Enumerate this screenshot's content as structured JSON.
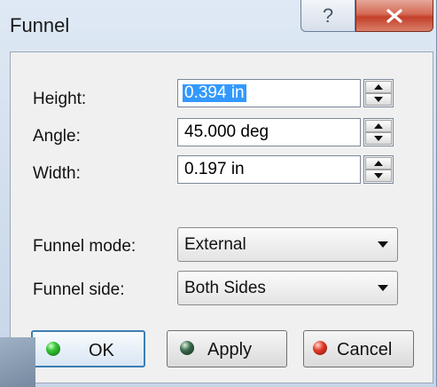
{
  "window": {
    "title": "Funnel"
  },
  "titlebar": {
    "help_glyph": "?",
    "close_icon": "close-icon"
  },
  "params": [
    {
      "key": "height",
      "label": "Height:",
      "value": "0.394 in",
      "selected": true
    },
    {
      "key": "angle",
      "label": "Angle:",
      "value": "45.000 deg",
      "selected": false
    },
    {
      "key": "width",
      "label": "Width:",
      "value": "0.197 in",
      "selected": false
    }
  ],
  "options": [
    {
      "key": "mode",
      "label": "Funnel mode:",
      "value": "External"
    },
    {
      "key": "side",
      "label": "Funnel side:",
      "value": "Both Sides"
    }
  ],
  "buttons": {
    "ok": "OK",
    "apply": "Apply",
    "cancel": "Cancel"
  },
  "colors": {
    "selection": "#3399ff",
    "ok_indicator": "#38c638",
    "apply_indicator": "#3d6a4f",
    "cancel_indicator": "#e33a27"
  }
}
